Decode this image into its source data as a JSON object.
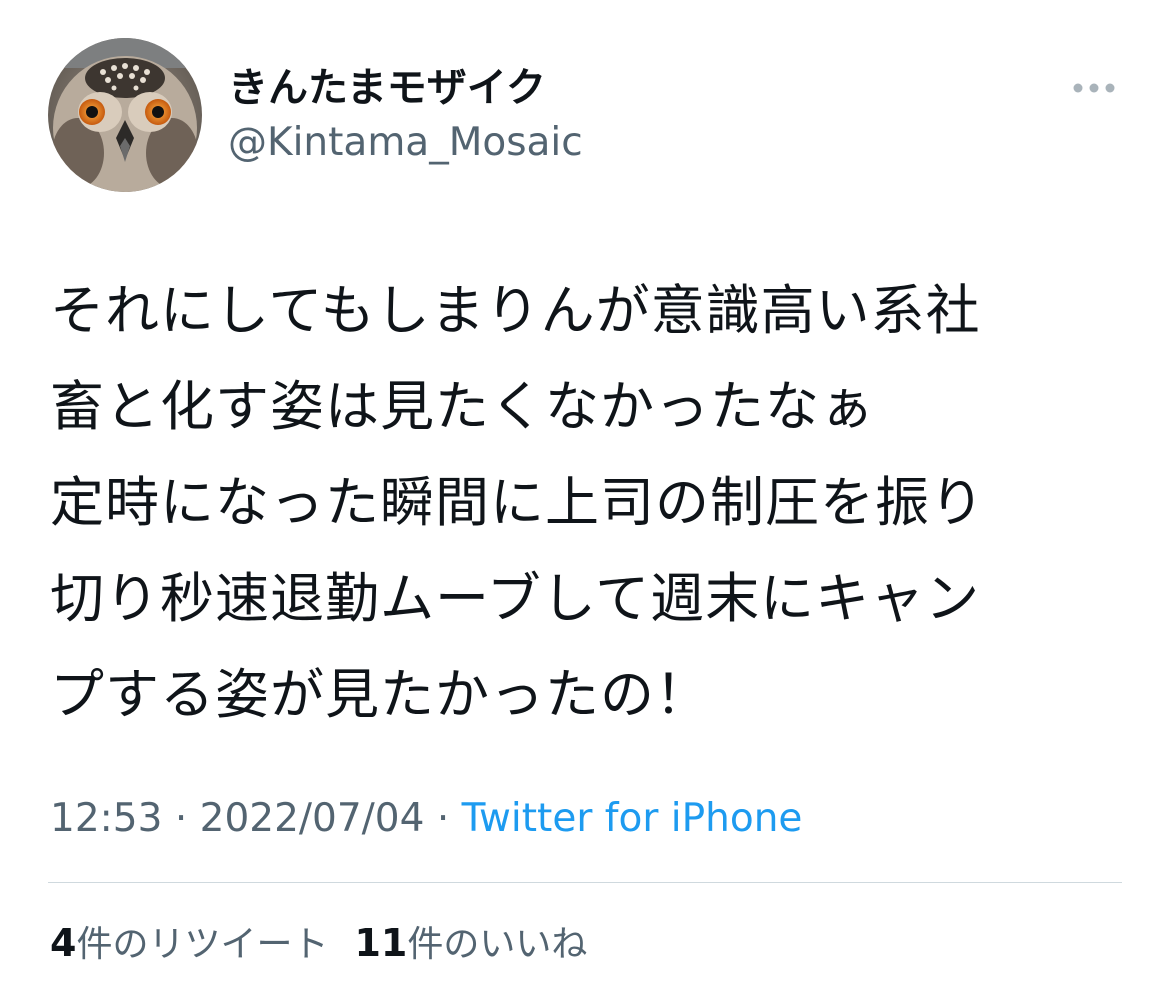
{
  "user": {
    "display_name": "きんたまモザイク",
    "handle": "@Kintama_Mosaic",
    "avatar_icon": "owl-avatar"
  },
  "more_icon": "more-horizontal-icon",
  "tweet": {
    "lines": [
      "それにしてもしまりんが意識高い系社",
      "畜と化す姿は見たくなかったなぁ",
      "定時になった瞬間に上司の制圧を振り",
      "切り秒速退勤ムーブして週末にキャン",
      "プする姿が見たかったの！"
    ]
  },
  "meta": {
    "time": "12:53",
    "separator": "·",
    "date": "2022/07/04",
    "source": "Twitter for iPhone"
  },
  "stats": {
    "retweets_count": "4",
    "retweets_label": "件のリツイート",
    "likes_count": "11",
    "likes_label": "件のいいね"
  },
  "colors": {
    "text": "#0f1419",
    "secondary": "#536471",
    "link": "#1d9bf0",
    "divider": "#cfd9de"
  }
}
